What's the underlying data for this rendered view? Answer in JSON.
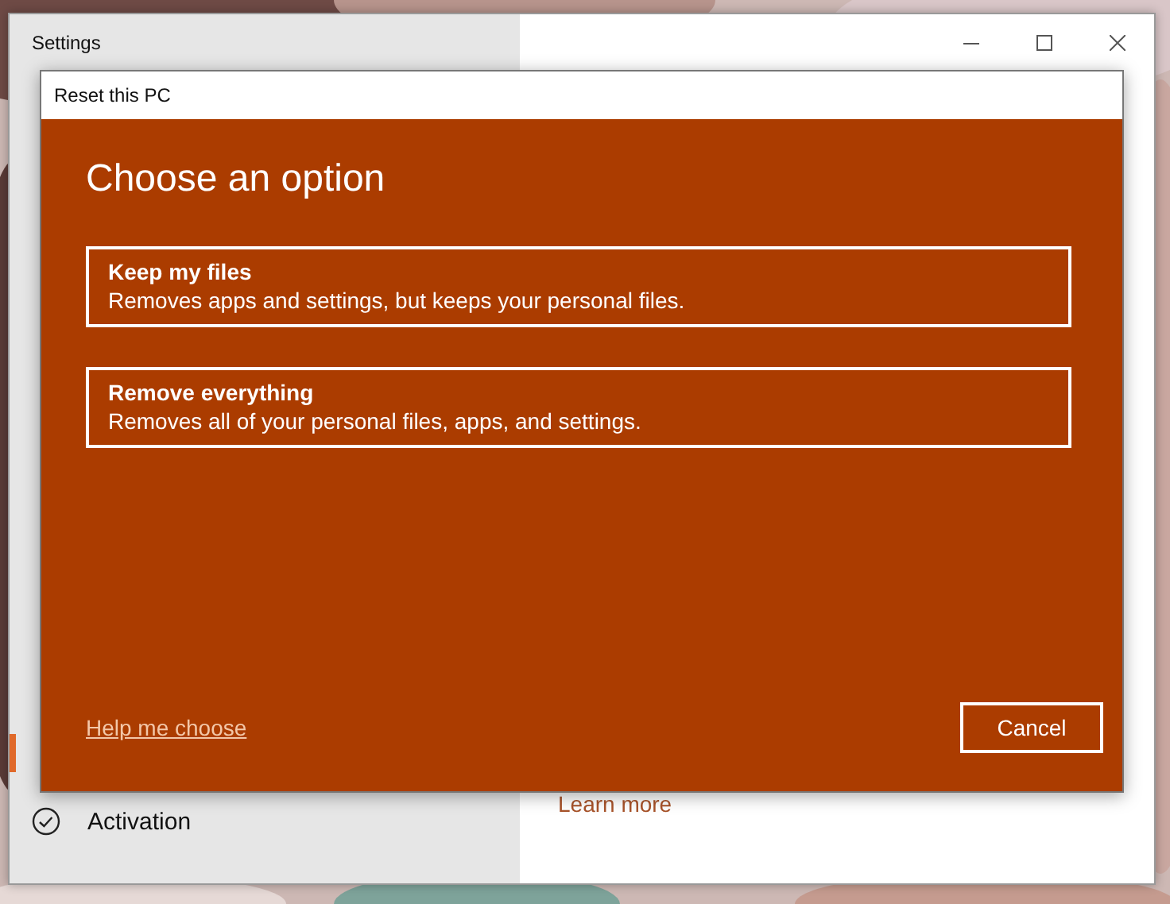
{
  "window": {
    "title": "Settings"
  },
  "sidebar": {
    "items": [
      {
        "label": "Activation"
      }
    ]
  },
  "content": {
    "link": "Learn more"
  },
  "dialog": {
    "title": "Reset this PC",
    "heading": "Choose an option",
    "options": [
      {
        "title": "Keep my files",
        "description": "Removes apps and settings, but keeps your personal files."
      },
      {
        "title": "Remove everything",
        "description": "Removes all of your personal files, apps, and settings."
      }
    ],
    "help_link": "Help me choose",
    "cancel": "Cancel"
  }
}
